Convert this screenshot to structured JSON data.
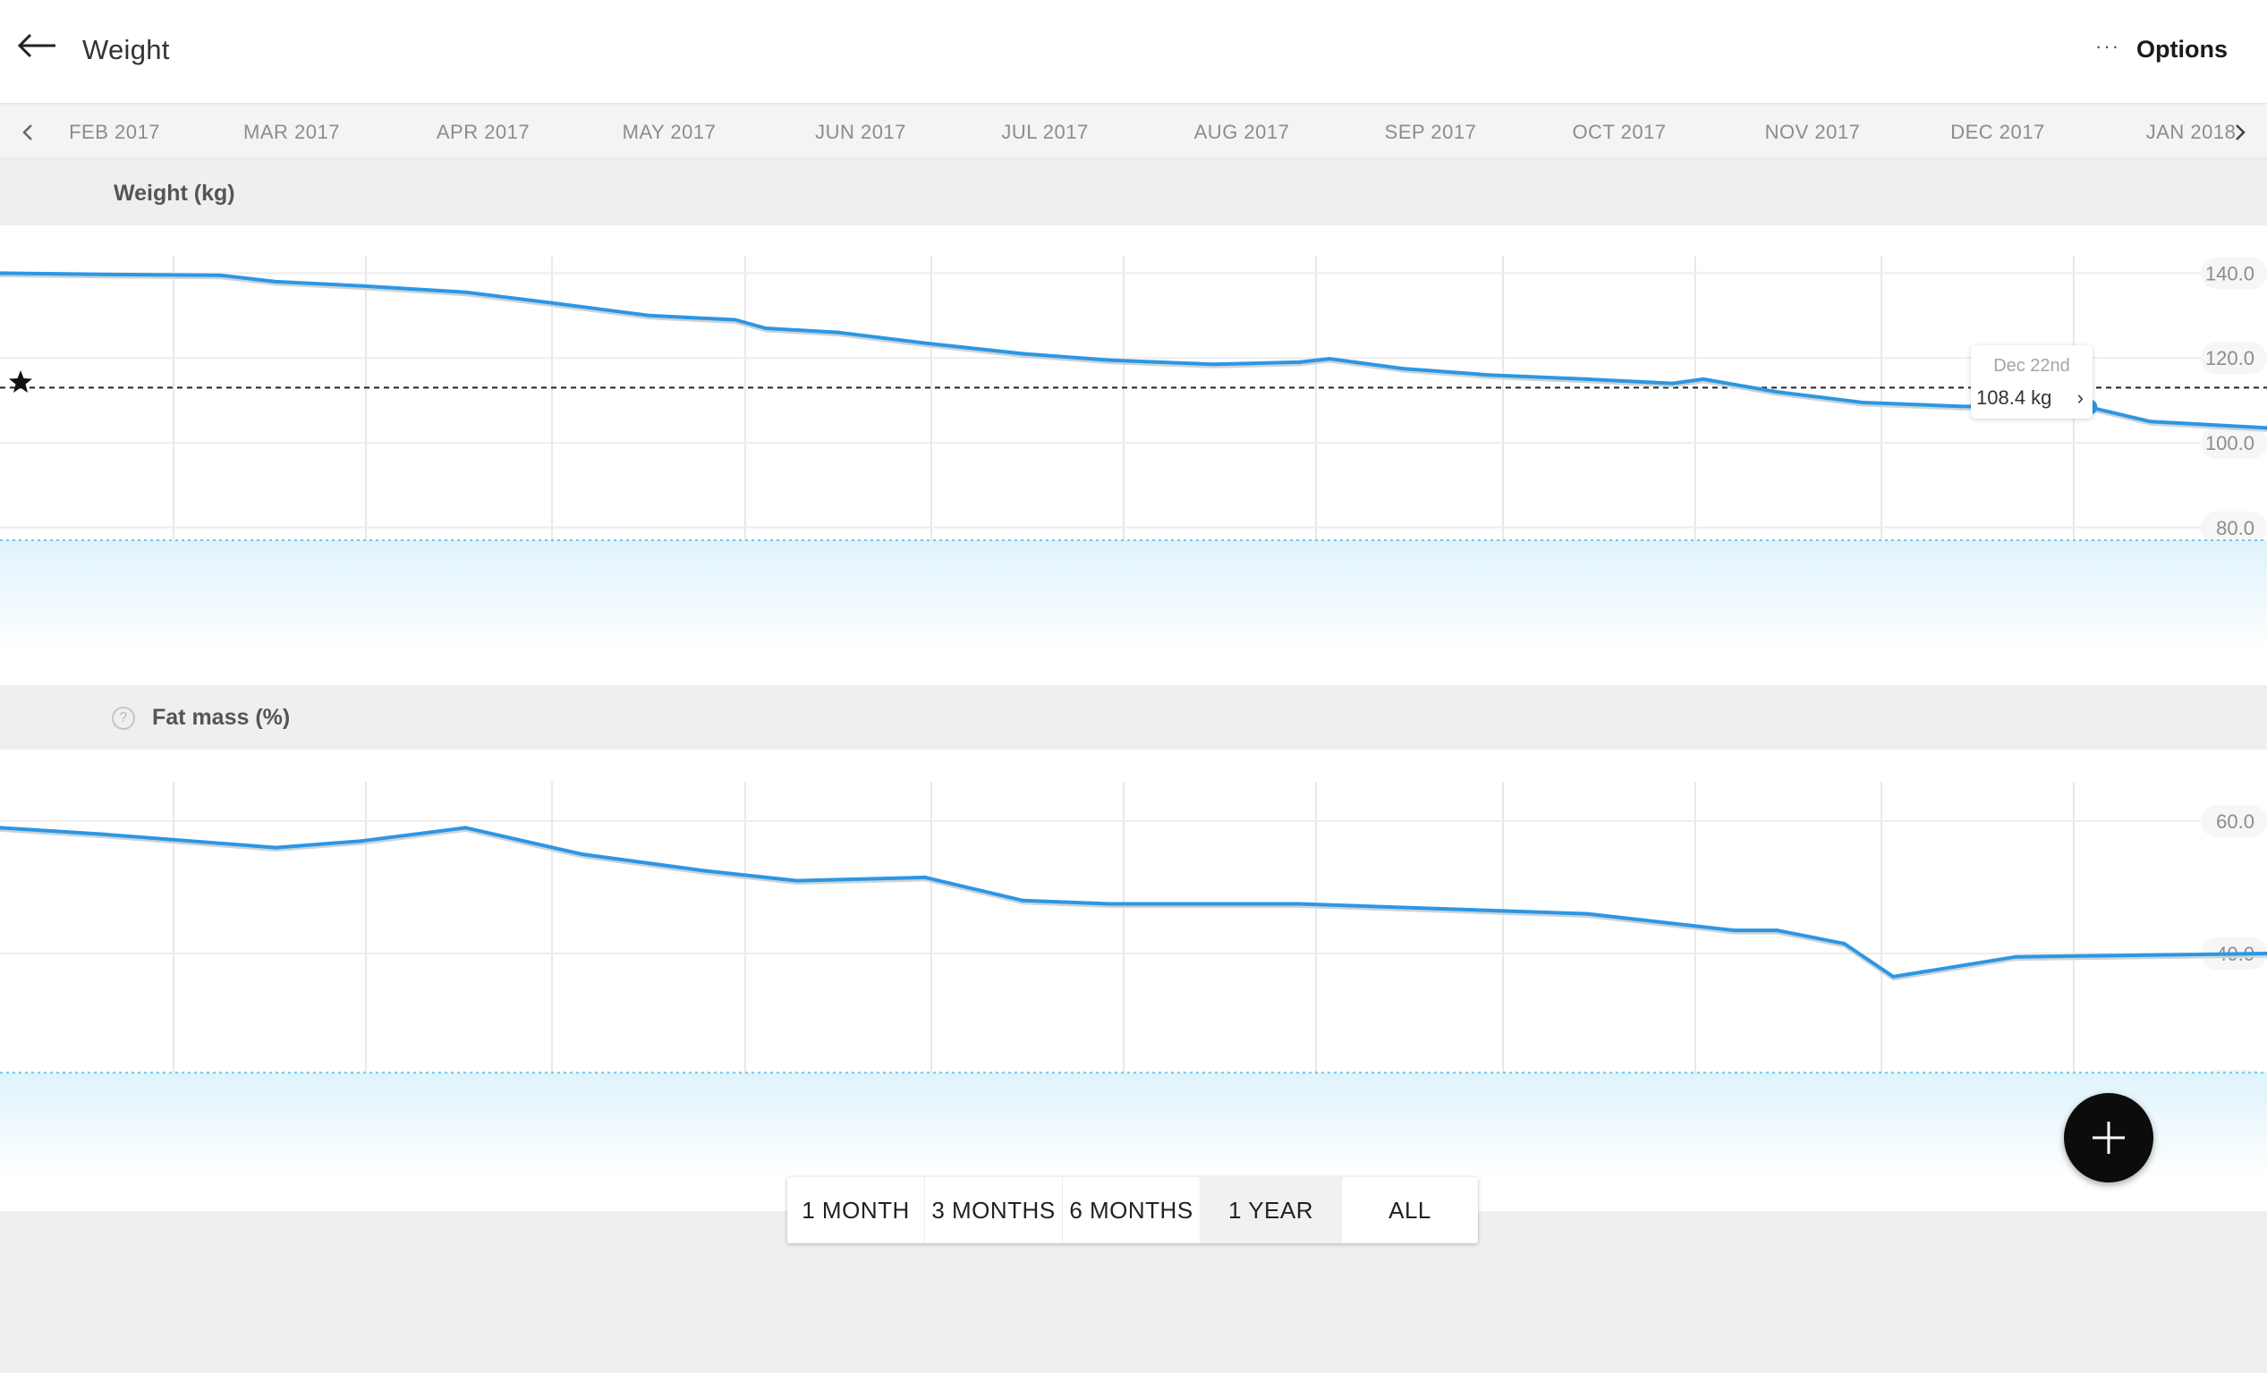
{
  "header": {
    "title": "Weight",
    "options_label": "Options"
  },
  "timeline": {
    "months": [
      "FEB 2017",
      "MAR 2017",
      "APR 2017",
      "MAY 2017",
      "JUN 2017",
      "JUL 2017",
      "AUG 2017",
      "SEP 2017",
      "OCT 2017",
      "NOV 2017",
      "DEC 2017",
      "JAN 2018"
    ]
  },
  "sections": {
    "weight_label": "Weight (kg)",
    "fat_label": "Fat mass (%)",
    "help_glyph": "?"
  },
  "tooltip": {
    "date": "Dec 22nd",
    "value": "108.4 kg"
  },
  "range_selector": {
    "options": [
      "1 MONTH",
      "3 MONTHS",
      "6 MONTHS",
      "1 YEAR",
      "ALL"
    ],
    "selected": "1 YEAR"
  },
  "icons": {
    "back": "arrow-left-icon",
    "options": "more-dots-icon",
    "prev": "chevron-left-icon",
    "next": "chevron-right-icon",
    "goal": "star-icon",
    "add": "plus-icon",
    "help": "question-circle-icon"
  },
  "colors": {
    "line": "#2b97e5",
    "raw_line": "#cdd3d6",
    "goal_band": "#dff3fb",
    "goal_line": "#6fc6e6"
  },
  "chart_data": [
    {
      "type": "line",
      "title": "Weight (kg)",
      "x_domain": [
        "2017-01-15",
        "2018-01-20"
      ],
      "ylim": [
        50,
        150
      ],
      "y_ticks": [
        140.0,
        120.0,
        100.0,
        80.0,
        60.0
      ],
      "goal_weight": 113,
      "target_range_top": 77,
      "grid": true,
      "series": [
        {
          "x": [
            "2017-01-15",
            "2017-02-01",
            "2017-02-20",
            "2017-03-01",
            "2017-03-15",
            "2017-04-01",
            "2017-04-15",
            "2017-05-01",
            "2017-05-15",
            "2017-05-20",
            "2017-06-01",
            "2017-06-15",
            "2017-07-01",
            "2017-07-15",
            "2017-08-01",
            "2017-08-15",
            "2017-08-20",
            "2017-09-01",
            "2017-09-15",
            "2017-10-01",
            "2017-10-15",
            "2017-10-20",
            "2017-11-01",
            "2017-11-15",
            "2017-12-01",
            "2017-12-22",
            "2018-01-01",
            "2018-01-20"
          ],
          "values": [
            140.0,
            139.7,
            139.5,
            138.0,
            137.0,
            135.5,
            133.0,
            130.0,
            129.0,
            127.0,
            126.0,
            123.5,
            121.0,
            119.5,
            118.5,
            119.0,
            119.8,
            117.5,
            116.0,
            115.0,
            114.0,
            115.0,
            112.0,
            109.5,
            108.6,
            108.4,
            105.0,
            103.5
          ]
        }
      ]
    },
    {
      "type": "line",
      "title": "Fat mass (%)",
      "x_domain": [
        "2017-01-15",
        "2018-01-20"
      ],
      "ylim": [
        10,
        70
      ],
      "y_ticks": [
        60.0,
        40.0,
        20.0
      ],
      "target_range_top": 22,
      "grid": true,
      "series": [
        {
          "x": [
            "2017-01-15",
            "2017-02-01",
            "2017-03-01",
            "2017-03-15",
            "2017-04-01",
            "2017-04-20",
            "2017-05-10",
            "2017-05-25",
            "2017-06-15",
            "2017-07-01",
            "2017-07-15",
            "2017-08-15",
            "2017-10-01",
            "2017-10-25",
            "2017-11-01",
            "2017-11-12",
            "2017-11-20",
            "2017-12-10",
            "2018-01-20"
          ],
          "values": [
            59.0,
            58.0,
            56.0,
            57.0,
            59.0,
            55.0,
            52.5,
            51.0,
            51.5,
            48.0,
            47.5,
            47.5,
            46.0,
            43.5,
            43.5,
            41.5,
            36.5,
            39.5,
            40.0
          ]
        }
      ]
    }
  ]
}
